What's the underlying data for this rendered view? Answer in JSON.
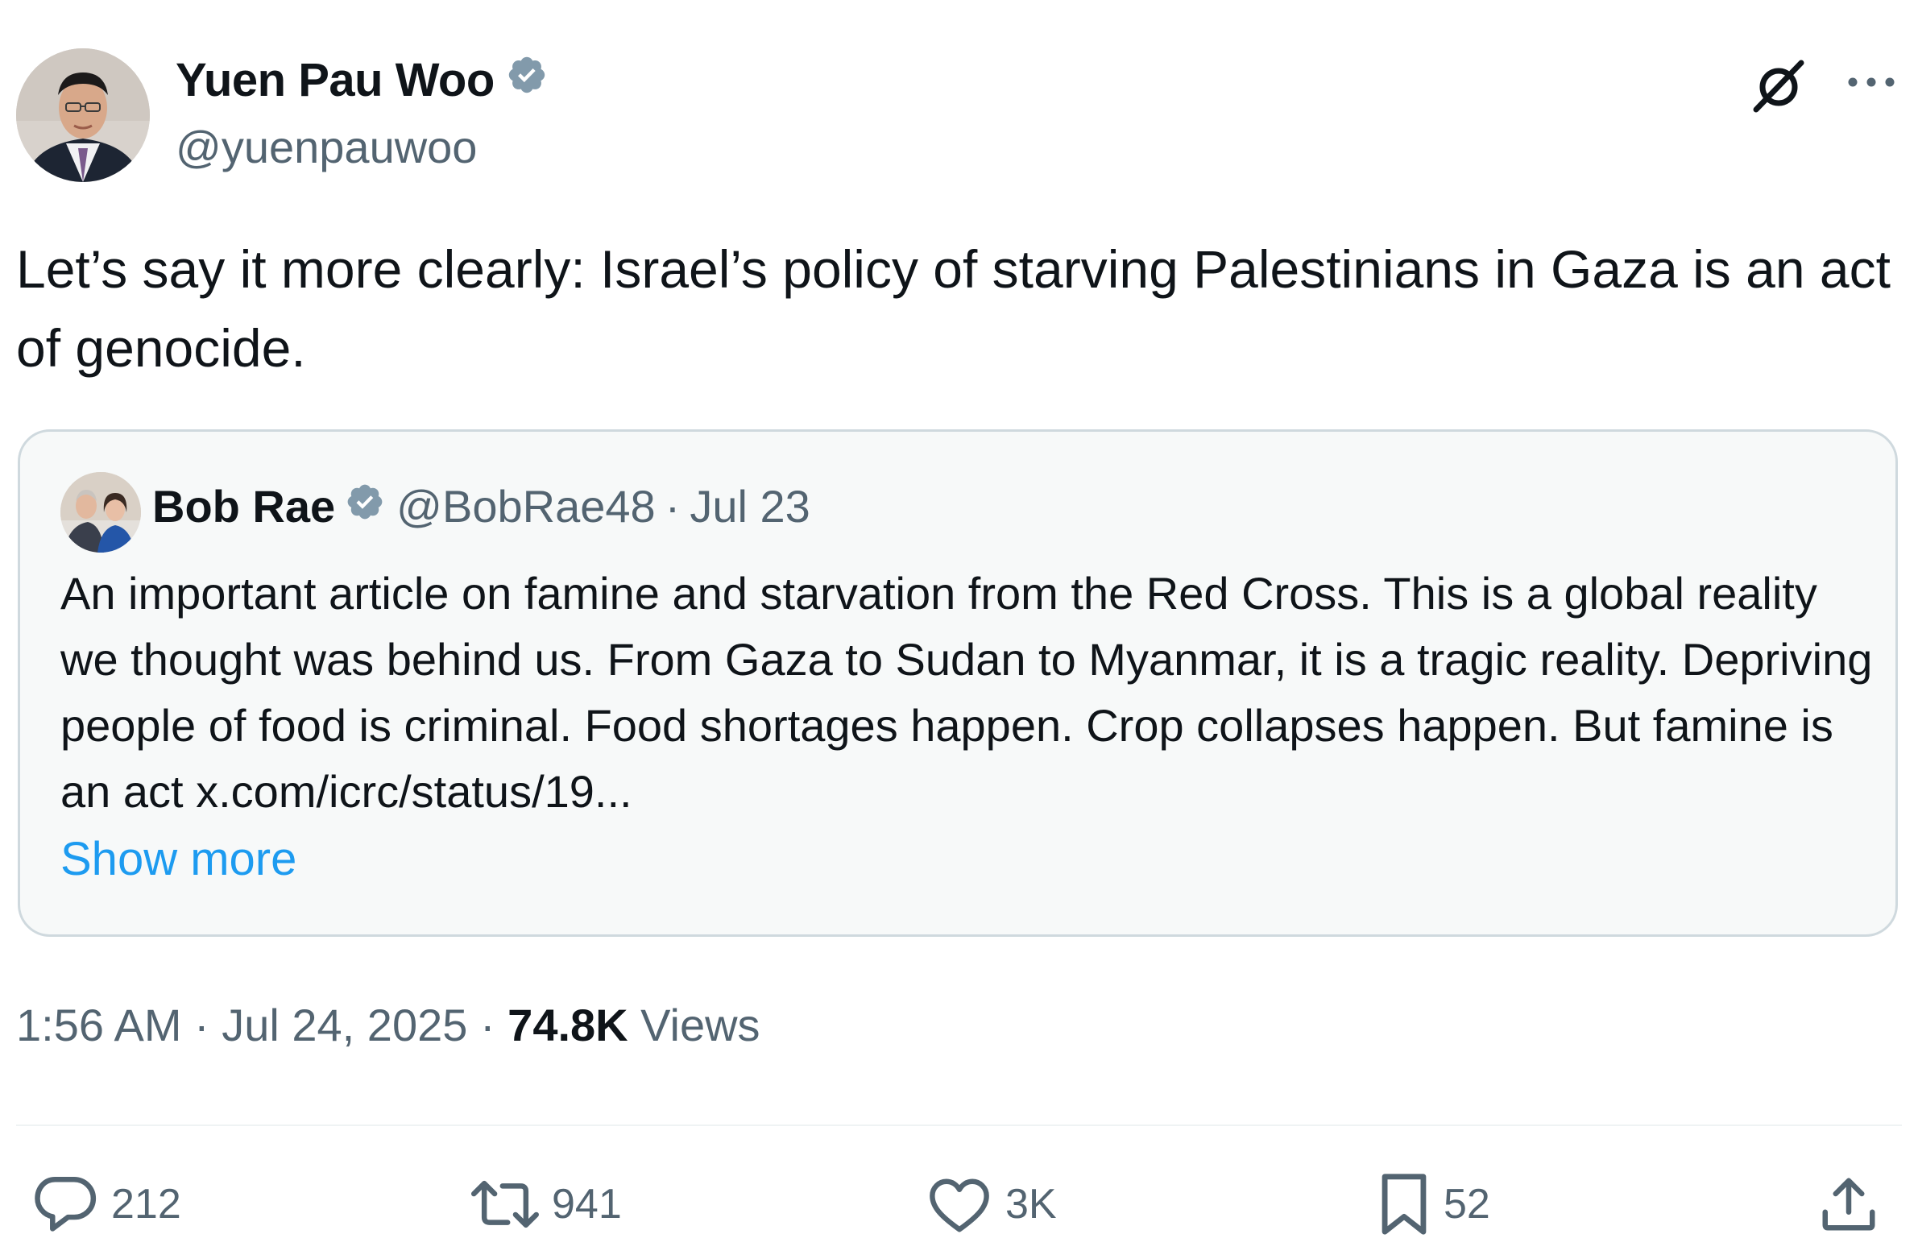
{
  "author": {
    "display_name": "Yuen Pau Woo",
    "handle": "@yuenpauwoo",
    "verified_icon": "verified-badge-icon"
  },
  "header_icons": {
    "grok": "grok-icon",
    "more": "more-icon"
  },
  "tweet_text": "Let’s say it more clearly: Israel’s policy of starving Palestinians in Gaza is an act of genocide.",
  "quote": {
    "display_name": "Bob Rae",
    "handle": "@BobRae48",
    "separator": "·",
    "date": "Jul 23",
    "text": "An important article on famine and starvation from the Red Cross. This is a global reality we thought was behind us.  From Gaza to Sudan to Myanmar, it is a tragic reality. Depriving people of food is criminal.  Food shortages happen. Crop collapses happen. But famine is an act x.com/icrc/status/19...",
    "show_more": "Show more"
  },
  "meta": {
    "time": "1:56 AM",
    "separator": "·",
    "date": "Jul 24, 2025",
    "views_count": "74.8K",
    "views_label": "Views"
  },
  "actions": {
    "replies": "212",
    "reposts": "941",
    "likes": "3K",
    "bookmarks": "52"
  },
  "colors": {
    "text": "#0f1419",
    "secondary": "#536471",
    "link": "#1d9bf0",
    "verified": "#829aab",
    "border": "#cfd9de",
    "quote_bg": "#f7f9f9"
  }
}
